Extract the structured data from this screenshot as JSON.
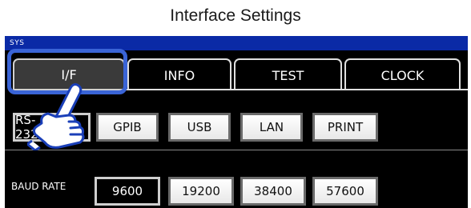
{
  "window": {
    "title": "Interface Settings"
  },
  "mode_bar": {
    "label": "SYS"
  },
  "tabs": [
    {
      "label": "I/F",
      "active": true
    },
    {
      "label": "INFO",
      "active": false
    },
    {
      "label": "TEST",
      "active": false
    },
    {
      "label": "CLOCK",
      "active": false
    }
  ],
  "interfaces": {
    "selected": "RS-232C",
    "items": [
      {
        "label": "RS-232C",
        "selected": true
      },
      {
        "label": "GPIB",
        "selected": false
      },
      {
        "label": "USB",
        "selected": false
      },
      {
        "label": "LAN",
        "selected": false
      },
      {
        "label": "PRINT",
        "selected": false
      }
    ]
  },
  "baud_rate": {
    "label": "BAUD RATE",
    "selected": "9600",
    "options": [
      {
        "label": "9600",
        "selected": true
      },
      {
        "label": "19200",
        "selected": false
      },
      {
        "label": "38400",
        "selected": false
      },
      {
        "label": "57600",
        "selected": false
      }
    ]
  },
  "colors": {
    "mode_bar": "#0a2aa6",
    "highlight": "#3a64d6",
    "screen_bg": "#000000"
  },
  "icons": {
    "pointer": "hand-pointer-icon"
  }
}
